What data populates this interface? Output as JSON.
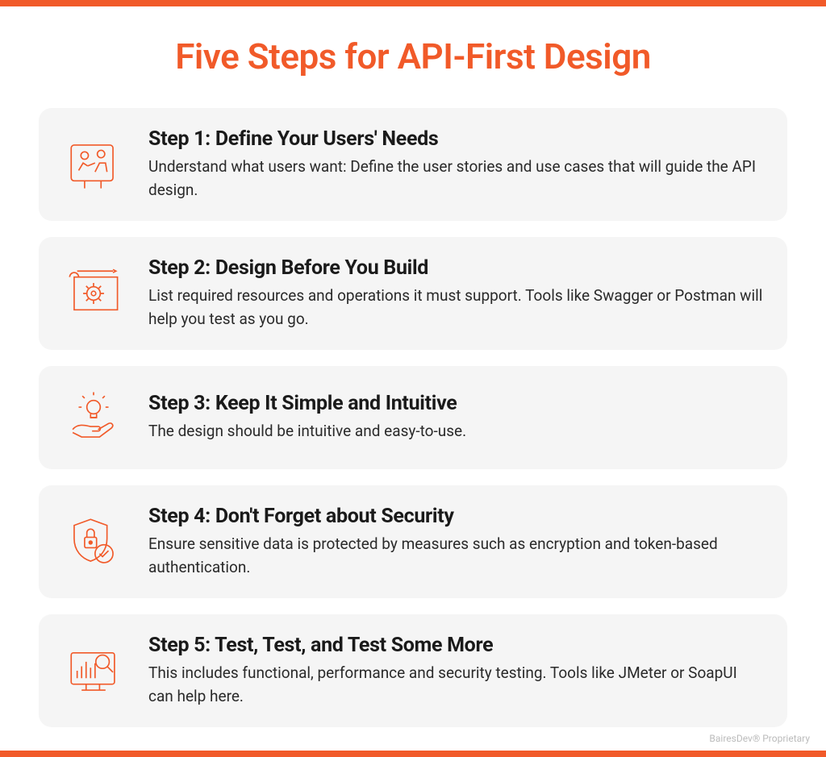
{
  "title": "Five Steps for API-First Design",
  "steps": [
    {
      "icon": "users-meeting-icon",
      "title": "Step 1: Define Your Users' Needs",
      "description": "Understand what users want: Define the user stories and use cases that will guide the API design."
    },
    {
      "icon": "blueprint-gear-icon",
      "title": "Step 2: Design Before You Build",
      "description": "List required resources and operations it must support. Tools like Swagger or Postman will help you test as you go."
    },
    {
      "icon": "hand-lightbulb-icon",
      "title": "Step 3: Keep It Simple and Intuitive",
      "description": "The design should be intuitive and easy-to-use."
    },
    {
      "icon": "shield-lock-icon",
      "title": "Step 4: Don't Forget about Security",
      "description": "Ensure sensitive data is protected by measures such as encryption and token-based authentication."
    },
    {
      "icon": "monitor-analytics-icon",
      "title": "Step 5: Test, Test, and Test Some More",
      "description": "This includes functional, performance and security testing. Tools like JMeter or SoapUI can help here."
    }
  ],
  "footer": "BairesDev® Proprietary"
}
